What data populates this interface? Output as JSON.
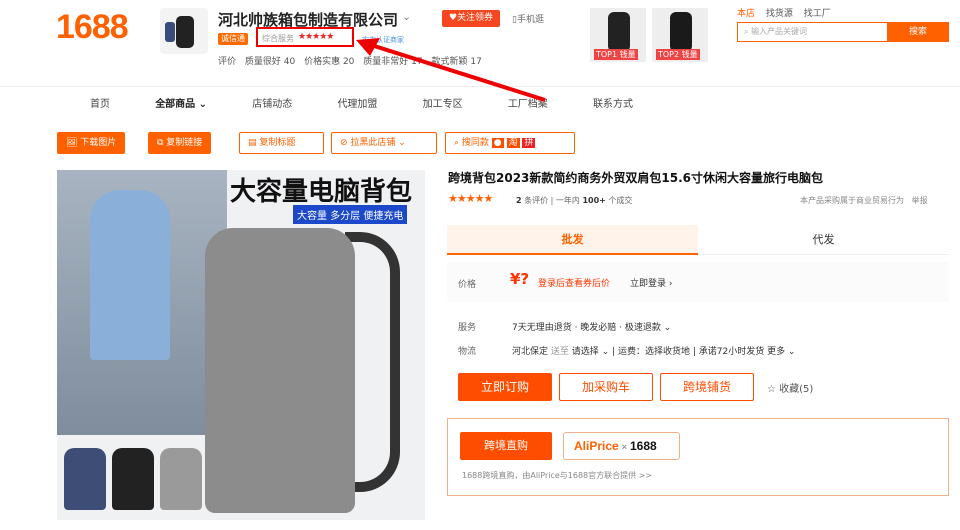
{
  "header": {
    "logo": "1688",
    "shop_name": "河北帅族箱包制造有限公司",
    "follow_label": "♥关注领券",
    "mobile_label": "▯手机逛",
    "year_badge": "诚信通",
    "service_label": "综合服务",
    "stars": "★★★★★",
    "verify_label": "实力认证商家",
    "ratings": [
      "评价",
      "质量很好 40",
      "价格实惠 20",
      "质量非常好 17",
      "款式新颖 17"
    ],
    "promos": [
      "TOP1 钱量",
      "TOP2 钱量"
    ],
    "top_links": [
      "本店",
      "找货源",
      "找工厂"
    ],
    "search_placeholder": "输入产品关键词",
    "search_button": "搜索"
  },
  "nav": [
    "首页",
    "全部商品",
    "店铺动态",
    "代理加盟",
    "加工专区",
    "工厂档案",
    "联系方式"
  ],
  "toolbar": [
    "下载图片",
    "复制链接",
    "复制标题",
    "拉黑此店铺",
    "搜同款"
  ],
  "image": {
    "title": "大容量电脑背包",
    "subtitle": "大容量  多分层  便捷充电"
  },
  "product": {
    "title": "跨境背包2023新款简约商务外贸双肩包15.6寸休闲大容量旅行电脑包",
    "stars": "★★★★★",
    "reviews_num": "2",
    "reviews_label": "条评价",
    "year_label": "一年内",
    "sold_num": "100+",
    "sold_label": "个成交",
    "right_text": "本产品采购属于商业贸易行为",
    "report": "举报",
    "tabs": [
      "批发",
      "代发"
    ],
    "price_label": "价格",
    "price_symbol": "¥?",
    "price_login": "登录后查看券后价",
    "price_now": "立即登录 ›",
    "service_label": "服务",
    "service_value": "7天无理由退货 · 晚发必赔 · 极速退款 ⌄",
    "ship_label": "物流",
    "ship_from": "河北保定",
    "ship_to_label": "送至",
    "ship_to": "请选择 ⌄",
    "fee_label": "运费：",
    "fee_value": "选择收货地",
    "promise": "承诺72小时发货 更多 ⌄",
    "buy_button": "立即订购",
    "cart_button": "加采购车",
    "store_button": "跨境铺货",
    "fav_label": "☆ 收藏(5)",
    "cb_button": "跨境直购",
    "ali_name": "AliPrice",
    "ali_x": "×",
    "ali_num": "1688",
    "cb_note": "1688跨境直购，由AliPrice与1688官方联合提供 >>"
  },
  "colors": {
    "brand": "#ff6000",
    "action": "#ff4d00",
    "annotation": "#e00000"
  }
}
